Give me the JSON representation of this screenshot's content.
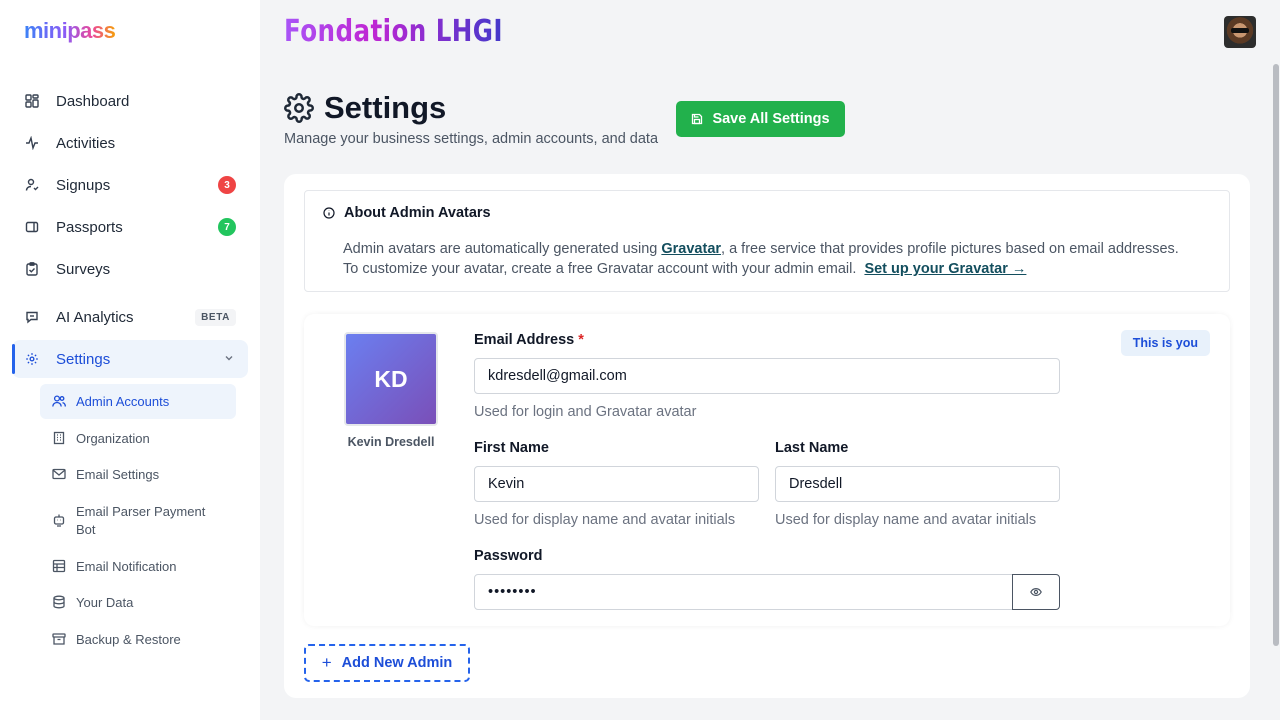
{
  "app": {
    "logo": "minipass",
    "org_name": "Fondation LHGI"
  },
  "sidebar": {
    "items": [
      {
        "label": "Dashboard",
        "icon": "dashboard-icon"
      },
      {
        "label": "Activities",
        "icon": "activity-icon"
      },
      {
        "label": "Signups",
        "icon": "signup-icon",
        "badge": "3"
      },
      {
        "label": "Passports",
        "icon": "passport-icon",
        "badge": "7"
      },
      {
        "label": "Surveys",
        "icon": "survey-icon"
      },
      {
        "label": "AI Analytics",
        "icon": "chat-icon",
        "tag": "BETA"
      },
      {
        "label": "Settings",
        "icon": "gear-icon"
      }
    ],
    "settings_sub": [
      {
        "label": "Admin Accounts"
      },
      {
        "label": "Organization"
      },
      {
        "label": "Email Settings"
      },
      {
        "label": "Email Parser Payment Bot"
      },
      {
        "label": "Email Notification"
      },
      {
        "label": "Your Data"
      },
      {
        "label": "Backup & Restore"
      }
    ]
  },
  "page": {
    "title": "Settings",
    "subtitle": "Manage your business settings, admin accounts, and data",
    "save_label": "Save All Settings"
  },
  "info": {
    "title": "About Admin Avatars",
    "line1_pre": "Admin avatars are automatically generated using",
    "line1_link": "Gravatar",
    "line1_post": ", a free service that provides profile pictures based on email addresses.",
    "line2_pre": "To customize your avatar, create a free Gravatar account with your admin email.",
    "line2_link": "Set up your Gravatar →"
  },
  "admin": {
    "initials": "KD",
    "name": "Kevin Dresdell",
    "you_badge": "This is you",
    "email_label": "Email Address",
    "required_mark": "*",
    "email": "kdresdell@gmail.com",
    "email_help": "Used for login and Gravatar avatar",
    "first_label": "First Name",
    "first": "Kevin",
    "first_help": "Used for display name and avatar initials",
    "last_label": "Last Name",
    "last": "Dresdell",
    "last_help": "Used for display name and avatar initials",
    "password_label": "Password",
    "password": "••••••••"
  },
  "add_admin_label": "Add New Admin"
}
